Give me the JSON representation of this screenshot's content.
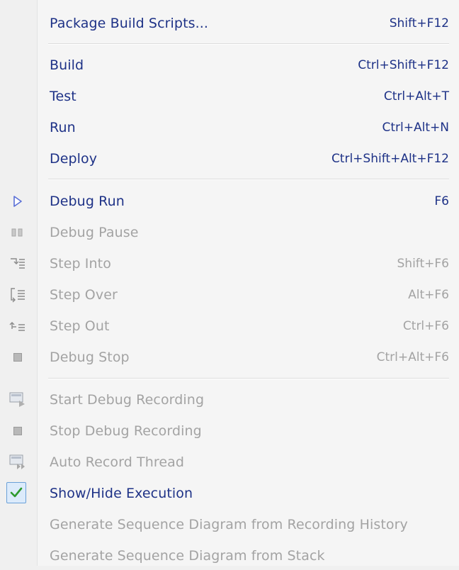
{
  "menu": {
    "items": [
      {
        "label": "Package Build Scripts...",
        "shortcut": "Shift+F12",
        "enabled": true,
        "icon": "none"
      },
      {
        "label": "Build",
        "shortcut": "Ctrl+Shift+F12",
        "enabled": true,
        "icon": "none"
      },
      {
        "label": "Test",
        "shortcut": "Ctrl+Alt+T",
        "enabled": true,
        "icon": "none"
      },
      {
        "label": "Run",
        "shortcut": "Ctrl+Alt+N",
        "enabled": true,
        "icon": "none"
      },
      {
        "label": "Deploy",
        "shortcut": "Ctrl+Shift+Alt+F12",
        "enabled": true,
        "icon": "none"
      },
      {
        "label": "Debug Run",
        "shortcut": "F6",
        "enabled": true,
        "icon": "play-icon"
      },
      {
        "label": "Debug Pause",
        "shortcut": "",
        "enabled": false,
        "icon": "pause-icon"
      },
      {
        "label": "Step Into",
        "shortcut": "Shift+F6",
        "enabled": false,
        "icon": "step-into-icon"
      },
      {
        "label": "Step Over",
        "shortcut": "Alt+F6",
        "enabled": false,
        "icon": "step-over-icon"
      },
      {
        "label": "Step Out",
        "shortcut": "Ctrl+F6",
        "enabled": false,
        "icon": "step-out-icon"
      },
      {
        "label": "Debug Stop",
        "shortcut": "Ctrl+Alt+F6",
        "enabled": false,
        "icon": "stop-icon"
      },
      {
        "label": "Start Debug Recording",
        "shortcut": "",
        "enabled": false,
        "icon": "start-recording-icon"
      },
      {
        "label": "Stop Debug Recording",
        "shortcut": "",
        "enabled": false,
        "icon": "stop-icon"
      },
      {
        "label": "Auto Record Thread",
        "shortcut": "",
        "enabled": false,
        "icon": "auto-record-icon"
      },
      {
        "label": "Show/Hide Execution",
        "shortcut": "",
        "enabled": true,
        "checked": true,
        "icon": "checkmark-icon"
      },
      {
        "label": "Generate Sequence Diagram from Recording History",
        "shortcut": "",
        "enabled": false,
        "icon": "none"
      },
      {
        "label": "Generate Sequence Diagram from Stack",
        "shortcut": "",
        "enabled": false,
        "icon": "none"
      }
    ]
  },
  "colors": {
    "enabled_text": "#1e3287",
    "disabled_text": "#a3a3a3",
    "play_icon": "#5a6fd6",
    "check_icon": "#2e9a2e"
  }
}
